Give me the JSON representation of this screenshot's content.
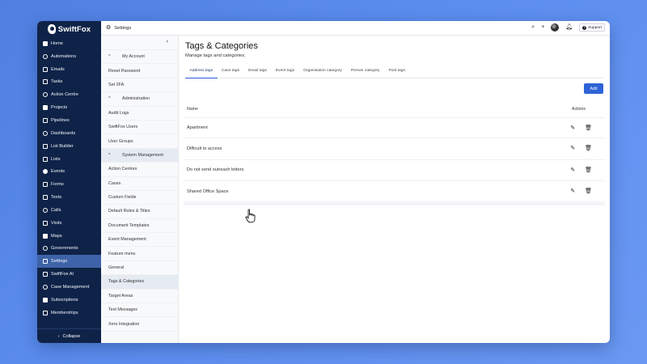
{
  "app": {
    "logo_text": "SwiftFox"
  },
  "nav": {
    "items": [
      {
        "label": "Home",
        "icon": "home-icon"
      },
      {
        "label": "Automations",
        "icon": "automations-icon"
      },
      {
        "label": "Emails",
        "icon": "mail-icon"
      },
      {
        "label": "Tasks",
        "icon": "check-circle-icon"
      },
      {
        "label": "Action Centre",
        "icon": "action-centre-icon"
      },
      {
        "label": "Projects",
        "icon": "projects-icon"
      },
      {
        "label": "Pipelines",
        "icon": "filter-icon"
      },
      {
        "label": "Dashboards",
        "icon": "dashboard-icon"
      },
      {
        "label": "List Builder",
        "icon": "list-builder-icon"
      },
      {
        "label": "Lists",
        "icon": "list-icon"
      },
      {
        "label": "Events",
        "icon": "calendar-icon"
      },
      {
        "label": "Forms",
        "icon": "form-icon"
      },
      {
        "label": "Texts",
        "icon": "message-icon"
      },
      {
        "label": "Calls",
        "icon": "phone-icon"
      },
      {
        "label": "Visits",
        "icon": "visits-icon"
      },
      {
        "label": "Maps",
        "icon": "map-icon"
      },
      {
        "label": "Governments",
        "icon": "government-icon"
      },
      {
        "label": "Settings",
        "icon": "gear-icon"
      },
      {
        "label": "SwiftFox AI",
        "icon": "ai-icon"
      },
      {
        "label": "Case Management",
        "icon": "case-icon"
      },
      {
        "label": "Subscriptions",
        "icon": "subscriptions-icon"
      },
      {
        "label": "Memberships",
        "icon": "memberships-icon"
      }
    ],
    "active_index": 17,
    "collapse_label": "Collapse"
  },
  "topbar": {
    "title": "Settings",
    "support_label": "Support"
  },
  "submenu": {
    "rows": [
      {
        "label": "My Account",
        "type": "section"
      },
      {
        "label": "Reset Password",
        "type": "item"
      },
      {
        "label": "Set 2FA",
        "type": "item"
      },
      {
        "label": "Administration",
        "type": "section"
      },
      {
        "label": "Audit Logs",
        "type": "item"
      },
      {
        "label": "SwiftFox Users",
        "type": "item"
      },
      {
        "label": "User Groups",
        "type": "item"
      },
      {
        "label": "System Management",
        "type": "section"
      },
      {
        "label": "Action Centres",
        "type": "item"
      },
      {
        "label": "Cases",
        "type": "item"
      },
      {
        "label": "Custom Fields",
        "type": "item"
      },
      {
        "label": "Default Roles & Titles",
        "type": "item"
      },
      {
        "label": "Document Templates",
        "type": "item"
      },
      {
        "label": "Event Management",
        "type": "item"
      },
      {
        "label": "Feature menu",
        "type": "item"
      },
      {
        "label": "General",
        "type": "item"
      },
      {
        "label": "Tags & Categories",
        "type": "item"
      },
      {
        "label": "Target Areas",
        "type": "item"
      },
      {
        "label": "Text Messages",
        "type": "item"
      },
      {
        "label": "Xero Integration",
        "type": "item"
      }
    ],
    "active_label": "Tags & Categories"
  },
  "main": {
    "title": "Tags & Categories",
    "subtitle": "Manage tags and categories.",
    "tabs": [
      "Address tags",
      "Case tags",
      "Email tags",
      "Event tags",
      "Organisation category",
      "Person category",
      "Post tags"
    ],
    "active_tab": 0,
    "add_label": "Add",
    "table": {
      "col_name": "Name",
      "col_actions": "Actions",
      "rows": [
        "Apartment",
        "Difficult to access",
        "Do not send outreach letters",
        "Shared Office Space"
      ]
    }
  },
  "colors": {
    "nav_bg": "#0f2348",
    "nav_active": "#3f63a8",
    "accent": "#2d63d6",
    "background": "#5b8def"
  }
}
